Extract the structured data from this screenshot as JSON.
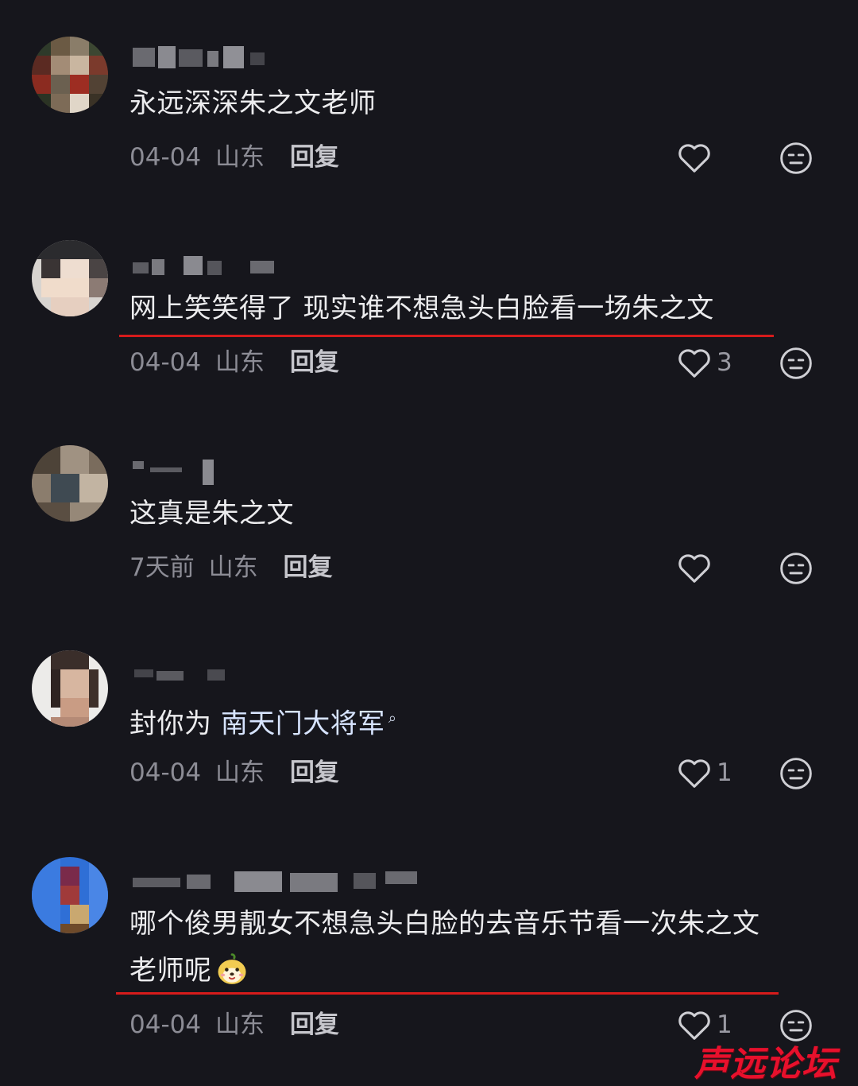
{
  "comments": [
    {
      "username": "",
      "text": "永远深深朱之文老师",
      "date": "04-04",
      "location": "山东",
      "reply_label": "回复",
      "likes": "",
      "liked": false,
      "highlighted": false
    },
    {
      "username": "",
      "text": "网上笑笑得了 现实谁不想急头白脸看一场朱之文",
      "date": "04-04",
      "location": "山东",
      "reply_label": "回复",
      "likes": "3",
      "liked": false,
      "highlighted": true
    },
    {
      "username": "",
      "text": "这真是朱之文",
      "date": "7天前",
      "location": "山东",
      "reply_label": "回复",
      "likes": "",
      "liked": false,
      "highlighted": false
    },
    {
      "username": "",
      "text_prefix": "封你为 ",
      "text_link": "南天门大将军",
      "date": "04-04",
      "location": "山东",
      "reply_label": "回复",
      "likes": "1",
      "liked": false,
      "highlighted": false
    },
    {
      "username": "",
      "text_line1": "哪个俊男靓女不想急头白脸的去音乐节看一次朱之文",
      "text_line2": "老师呢",
      "date": "04-04",
      "location": "山东",
      "reply_label": "回复",
      "likes": "1",
      "liked": false,
      "highlighted": true
    }
  ],
  "icons": {
    "like": "heart-outline-icon",
    "react": "neutral-face-icon",
    "search": "search-icon",
    "emoji": "dog-face-emoji"
  },
  "colors": {
    "background": "#16161c",
    "text": "#ececee",
    "meta": "#8c8c95",
    "highlight_underline": "#d61b1b",
    "link": "#d7e4ff",
    "watermark": "#e8102c"
  },
  "watermark": "声远论坛"
}
